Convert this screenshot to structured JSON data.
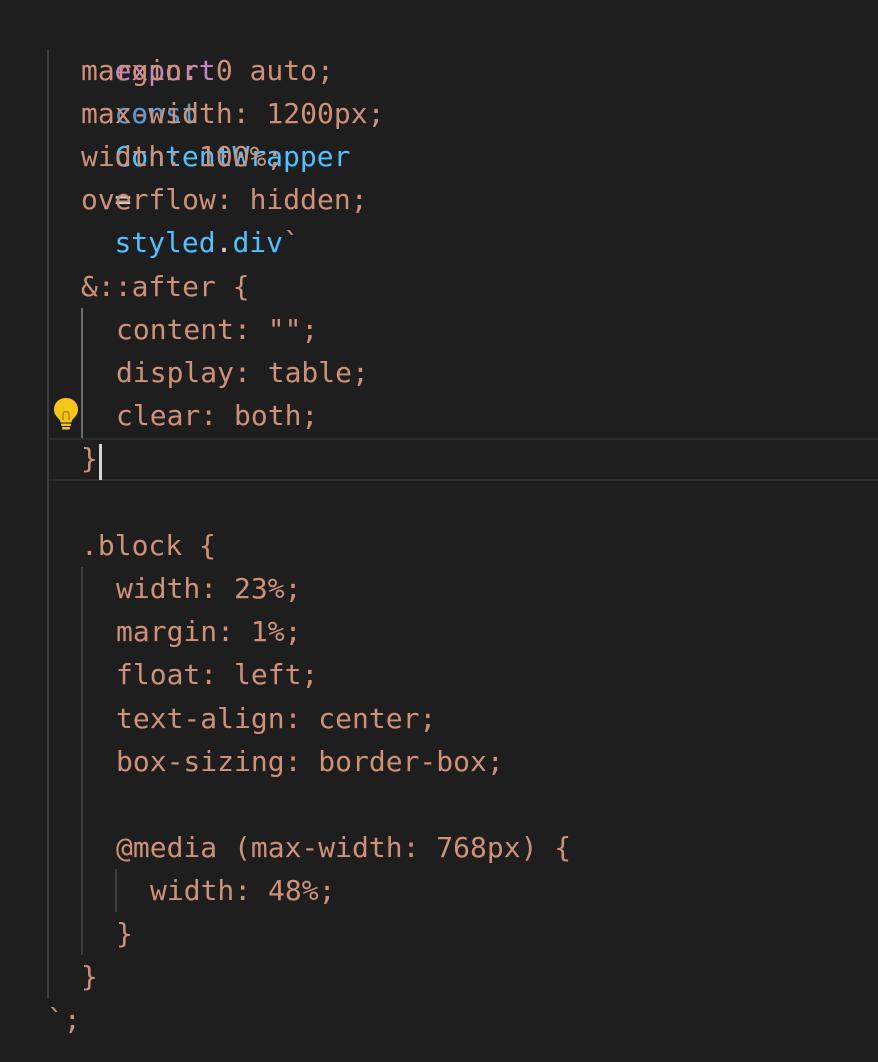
{
  "code": {
    "line1": {
      "export_kw": "export",
      "const_kw": "const",
      "name": "ContentWrapper",
      "eq": "=",
      "styled": "styled",
      "dot": ".",
      "tag": "div",
      "tick": "`"
    },
    "lines": [
      "margin: 0 auto;",
      "max-width: 1200px;",
      "width: 100%;",
      "overflow: hidden;",
      "",
      "&::after {",
      "content: \"\";",
      "display: table;",
      "clear: both;",
      "}",
      "",
      ".block {",
      "width: 23%;",
      "margin: 1%;",
      "float: left;",
      "text-align: center;",
      "box-sizing: border-box;",
      "",
      "@media (max-width: 768px) {",
      "width: 48%;",
      "}",
      "}",
      "`;"
    ]
  },
  "icons": {
    "lightbulb": "lightbulb-icon"
  },
  "colors": {
    "background": "#1e1e1e",
    "keyword": "#c586c0",
    "declaration": "#569cd6",
    "identifier": "#4fc1ff",
    "string_template": "#ce9178",
    "operator": "#d4d4d4",
    "lightbulb": "#f5c518"
  }
}
